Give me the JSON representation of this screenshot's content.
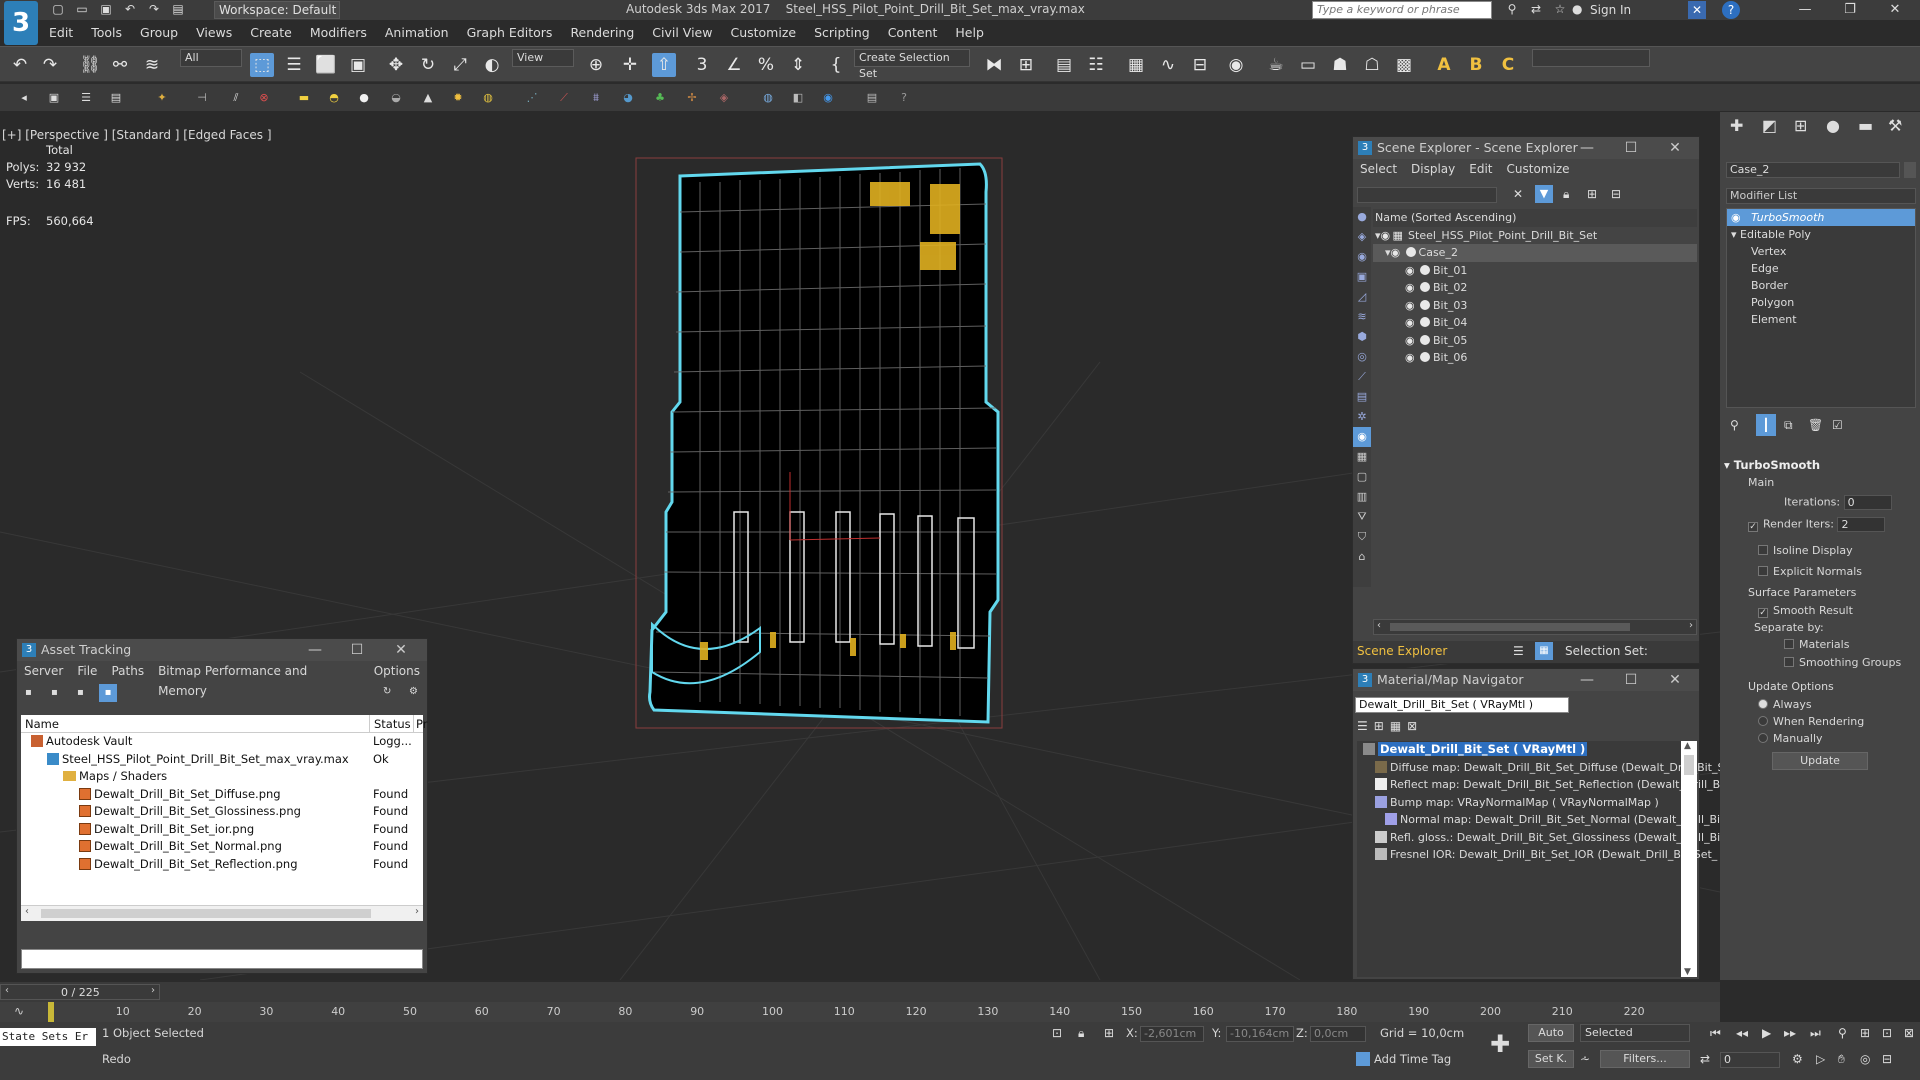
{
  "title_bar": {
    "workspace": "Workspace: Default",
    "app_title": "Autodesk 3ds Max 2017",
    "file_name": "Steel_HSS_Pilot_Point_Drill_Bit_Set_max_vray.max",
    "search_placeholder": "Type a keyword or phrase",
    "sign_in": "Sign In"
  },
  "menu": [
    "Edit",
    "Tools",
    "Group",
    "Views",
    "Create",
    "Modifiers",
    "Animation",
    "Graph Editors",
    "Rendering",
    "Civil View",
    "Customize",
    "Scripting",
    "Content",
    "Help"
  ],
  "toolbar": {
    "filter_value": "All",
    "view_value": "View",
    "selection_set": "Create Selection Set"
  },
  "viewport": {
    "label": "[+] [Perspective ] [Standard ] [Edged Faces ]",
    "total_label": "Total",
    "polys_label": "Polys:",
    "polys_value": "32 932",
    "verts_label": "Verts:",
    "verts_value": "16 481",
    "fps_label": "FPS:",
    "fps_value": "560,664"
  },
  "asset_tracking": {
    "title": "Asset Tracking",
    "menu": [
      "Server",
      "File",
      "Paths",
      "Bitmap Performance and Memory",
      "Options"
    ],
    "col_name": "Name",
    "col_status": "Status",
    "col_pr": "Pr",
    "rows": [
      {
        "name": "Autodesk Vault",
        "status": "Logg..."
      },
      {
        "name": "Steel_HSS_Pilot_Point_Drill_Bit_Set_max_vray.max",
        "status": "Ok"
      },
      {
        "name": "Maps / Shaders",
        "status": ""
      },
      {
        "name": "Dewalt_Drill_Bit_Set_Diffuse.png",
        "status": "Found"
      },
      {
        "name": "Dewalt_Drill_Bit_Set_Glossiness.png",
        "status": "Found"
      },
      {
        "name": "Dewalt_Drill_Bit_Set_ior.png",
        "status": "Found"
      },
      {
        "name": "Dewalt_Drill_Bit_Set_Normal.png",
        "status": "Found"
      },
      {
        "name": "Dewalt_Drill_Bit_Set_Reflection.png",
        "status": "Found"
      }
    ]
  },
  "scene_explorer": {
    "title": "Scene Explorer - Scene Explorer",
    "menu": [
      "Select",
      "Display",
      "Edit",
      "Customize"
    ],
    "header": "Name (Sorted Ascending)",
    "root": "Steel_HSS_Pilot_Point_Drill_Bit_Set",
    "case": "Case_2",
    "bits": [
      "Bit_01",
      "Bit_02",
      "Bit_03",
      "Bit_04",
      "Bit_05",
      "Bit_06"
    ],
    "footer_label": "Scene Explorer",
    "selection_set_label": "Selection Set:"
  },
  "material_navigator": {
    "title": "Material/Map Navigator",
    "field": "Dewalt_Drill_Bit_Set  ( VRayMtl )",
    "root": "Dewalt_Drill_Bit_Set  ( VRayMtl )",
    "maps": [
      "Diffuse map: Dewalt_Drill_Bit_Set_Diffuse (Dewalt_Drill_Bit_S",
      "Reflect map: Dewalt_Drill_Bit_Set_Reflection (Dewalt_Drill_Bi",
      "Bump map: VRayNormalMap  ( VRayNormalMap )",
      "Normal map: Dewalt_Drill_Bit_Set_Normal (Dewalt_Drill_Bit",
      "Refl. gloss.: Dewalt_Drill_Bit_Set_Glossiness (Dewalt_Drill_Bit",
      "Fresnel IOR: Dewalt_Drill_Bit_Set_IOR (Dewalt_Drill_Bit_Set_"
    ]
  },
  "command_panel": {
    "object_name": "Case_2",
    "modifier_list": "Modifier List",
    "stack": [
      "TurboSmooth",
      "Editable Poly",
      "Vertex",
      "Edge",
      "Border",
      "Polygon",
      "Element"
    ],
    "rollout_title": "TurboSmooth",
    "main_label": "Main",
    "iterations_label": "Iterations:",
    "iterations_value": "0",
    "render_iters_label": "Render Iters:",
    "render_iters_value": "2",
    "isoline": "Isoline Display",
    "explicit_normals": "Explicit Normals",
    "surface_params": "Surface Parameters",
    "smooth_result": "Smooth Result",
    "separate_by": "Separate by:",
    "materials": "Materials",
    "smoothing_groups": "Smoothing Groups",
    "update_options": "Update Options",
    "always": "Always",
    "when_rendering": "When Rendering",
    "manually": "Manually",
    "update_button": "Update"
  },
  "timeline": {
    "frame_counter": "0 / 225",
    "ticks": [
      "10",
      "20",
      "30",
      "40",
      "50",
      "60",
      "70",
      "80",
      "90",
      "100",
      "110",
      "120",
      "130",
      "140",
      "150",
      "160",
      "170",
      "180",
      "190",
      "200",
      "210",
      "220"
    ]
  },
  "status_bar": {
    "script_label": "State Sets Er",
    "selected_count": "1 Object Selected",
    "last_action": "Redo",
    "x_label": "X:",
    "x_value": "-2,601cm",
    "y_label": "Y:",
    "y_value": "-10,164cm",
    "z_label": "Z:",
    "z_value": "0,0cm",
    "grid": "Grid = 10,0cm",
    "add_time_tag": "Add Time Tag",
    "auto": "Auto",
    "setk": "Set K.",
    "selected_dropdown": "Selected",
    "filters": "Filters...",
    "frame_value": "0"
  },
  "colors": {
    "accent_blue": "#5d9ad8",
    "selection_cyan": "#62d8ee",
    "wire_white": "#e8e8e8",
    "label_yellow": "#e0b020"
  }
}
